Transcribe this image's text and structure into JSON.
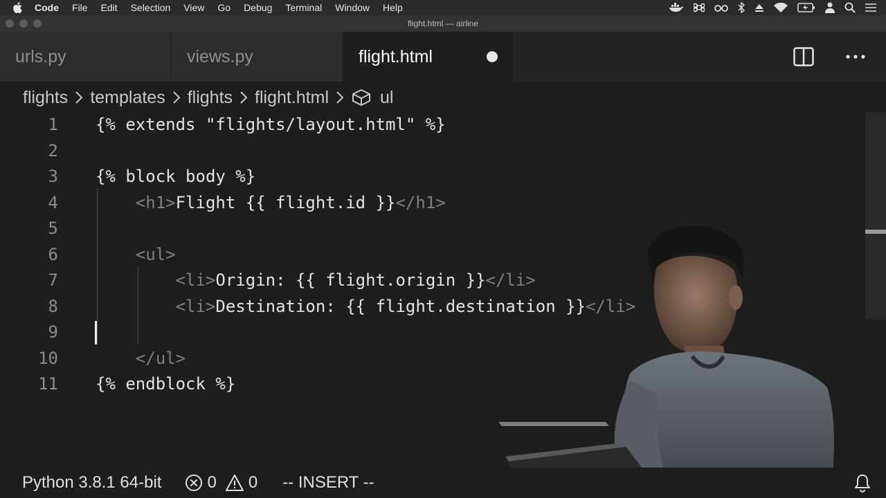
{
  "menubar": {
    "app_name": "Code",
    "items": [
      "File",
      "Edit",
      "Selection",
      "View",
      "Go",
      "Debug",
      "Terminal",
      "Window",
      "Help"
    ],
    "status_icons": [
      "docker-icon",
      "command-icon",
      "glasses-icon",
      "bluetooth-icon",
      "eject-icon",
      "wifi-icon",
      "battery-icon",
      "user-icon",
      "search-icon",
      "list-icon"
    ]
  },
  "window": {
    "title": "flight.html — airline"
  },
  "tabs": [
    {
      "label": "urls.py",
      "active": false,
      "dirty": false
    },
    {
      "label": "views.py",
      "active": false,
      "dirty": false
    },
    {
      "label": "flight.html",
      "active": true,
      "dirty": true
    }
  ],
  "tab_actions": [
    "split-editor-icon",
    "more-actions-icon"
  ],
  "breadcrumb": [
    "flights",
    "templates",
    "flights",
    "flight.html",
    "ul"
  ],
  "editor": {
    "lines": [
      {
        "n": "1",
        "segments": [
          {
            "t": "{% extends \"flights/layout.html\" %}",
            "c": "tpl"
          }
        ]
      },
      {
        "n": "2",
        "segments": []
      },
      {
        "n": "3",
        "segments": [
          {
            "t": "{% block body %}",
            "c": "tpl"
          }
        ]
      },
      {
        "n": "4",
        "segments": [
          {
            "t": "    ",
            "c": "tpl"
          },
          {
            "t": "<h1>",
            "c": "tagc"
          },
          {
            "t": "Flight {{ flight.id }}",
            "c": "tpl"
          },
          {
            "t": "</h1>",
            "c": "tagc"
          }
        ]
      },
      {
        "n": "5",
        "segments": []
      },
      {
        "n": "6",
        "segments": [
          {
            "t": "    ",
            "c": "tpl"
          },
          {
            "t": "<ul>",
            "c": "tagc"
          }
        ]
      },
      {
        "n": "7",
        "segments": [
          {
            "t": "        ",
            "c": "tpl"
          },
          {
            "t": "<li>",
            "c": "tagc"
          },
          {
            "t": "Origin: {{ flight.origin }}",
            "c": "tpl"
          },
          {
            "t": "</li>",
            "c": "tagc"
          }
        ]
      },
      {
        "n": "8",
        "segments": [
          {
            "t": "        ",
            "c": "tpl"
          },
          {
            "t": "<li>",
            "c": "tagc"
          },
          {
            "t": "Destination: {{ flight.destination }}",
            "c": "tpl"
          },
          {
            "t": "</li>",
            "c": "tagc"
          }
        ]
      },
      {
        "n": "9",
        "segments": []
      },
      {
        "n": "10",
        "segments": [
          {
            "t": "    ",
            "c": "tpl"
          },
          {
            "t": "</ul>",
            "c": "tagc"
          }
        ]
      },
      {
        "n": "11",
        "segments": [
          {
            "t": "{% endblock %}",
            "c": "tpl"
          }
        ]
      }
    ],
    "cursor_line": 9
  },
  "statusbar": {
    "python": "Python 3.8.1 64-bit",
    "errors": "0",
    "warnings": "0",
    "mode": "-- INSERT --"
  },
  "colors": {
    "editor_bg": "#1e1e1e",
    "tab_inactive_bg": "#2d2d2d",
    "tag_gray": "#7f7f7f",
    "text": "#e4e4e4"
  }
}
